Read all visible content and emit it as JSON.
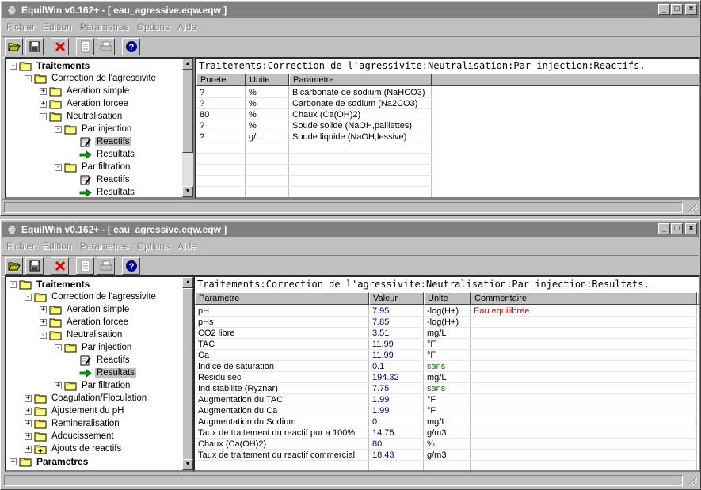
{
  "colors": {
    "title_inactive": "#808080",
    "selection": "#c0c0c0",
    "value_blue": "#000080",
    "comment_green": "#008000",
    "comment_red": "#c00000"
  },
  "windows": [
    {
      "title": "EquilWin v0.162+ - [ eau_agressive.eqw.eqw ]",
      "menu": [
        "Fichier",
        "Edition",
        "Parametres",
        "Options",
        "Aide"
      ],
      "toolbar": [
        "open-folder-icon",
        "save-disk-icon",
        "delete-x-icon",
        "copy-document-icon",
        "print-icon",
        "help-icon"
      ],
      "tree": [
        {
          "label": "Traitements",
          "level": 0,
          "expander": "-",
          "icon": "folder",
          "bold": true
        },
        {
          "label": "Correction de l'agressivite",
          "level": 1,
          "expander": "-",
          "icon": "folder"
        },
        {
          "label": "Aeration simple",
          "level": 2,
          "expander": "+",
          "icon": "folder"
        },
        {
          "label": "Aeration forcee",
          "level": 2,
          "expander": "+",
          "icon": "folder"
        },
        {
          "label": "Neutralisation",
          "level": 2,
          "expander": "-",
          "icon": "folder"
        },
        {
          "label": "Par injection",
          "level": 3,
          "expander": "-",
          "icon": "folder"
        },
        {
          "label": "Reactifs",
          "level": 4,
          "expander": "",
          "icon": "edit",
          "selected": true
        },
        {
          "label": "Resultats",
          "level": 4,
          "expander": "",
          "icon": "arrow"
        },
        {
          "label": "Par filtration",
          "level": 3,
          "expander": "-",
          "icon": "folder"
        },
        {
          "label": "Reactifs",
          "level": 4,
          "expander": "",
          "icon": "edit"
        },
        {
          "label": "Resultats",
          "level": 4,
          "expander": "",
          "icon": "arrow"
        }
      ],
      "path": "Traitements:Correction de l'agressivite:Neutralisation:Par injection:Reactifs.",
      "columns": [
        "Purete",
        "Unite",
        "Parametre"
      ],
      "rows": [
        [
          "?",
          "%",
          "Bicarbonate de sodium (NaHCO3)"
        ],
        [
          "?",
          "%",
          "Carbonate de sodium (Na2CO3)"
        ],
        [
          "80",
          "%",
          "Chaux (Ca(OH)2)"
        ],
        [
          "?",
          "%",
          "Soude solide (NaOH,paillettes)"
        ],
        [
          "?",
          "g/L",
          "Soude liquide (NaOH,lessive)"
        ]
      ]
    },
    {
      "title": "EquilWin v0.162+ - [ eau_agressive.eqw.eqw ]",
      "menu": [
        "Fichier",
        "Edition",
        "Parametres",
        "Options",
        "Aide"
      ],
      "toolbar": [
        "open-folder-icon",
        "save-disk-icon",
        "delete-x-icon",
        "copy-document-icon",
        "print-icon",
        "help-icon"
      ],
      "tree": [
        {
          "label": "Traitements",
          "level": 0,
          "expander": "-",
          "icon": "folder",
          "bold": true
        },
        {
          "label": "Correction de l'agressivite",
          "level": 1,
          "expander": "-",
          "icon": "folder"
        },
        {
          "label": "Aeration simple",
          "level": 2,
          "expander": "+",
          "icon": "folder"
        },
        {
          "label": "Aeration forcee",
          "level": 2,
          "expander": "+",
          "icon": "folder"
        },
        {
          "label": "Neutralisation",
          "level": 2,
          "expander": "-",
          "icon": "folder"
        },
        {
          "label": "Par injection",
          "level": 3,
          "expander": "-",
          "icon": "folder"
        },
        {
          "label": "Reactifs",
          "level": 4,
          "expander": "",
          "icon": "edit"
        },
        {
          "label": "Resultats",
          "level": 4,
          "expander": "",
          "icon": "arrow",
          "selected": true
        },
        {
          "label": "Par filtration",
          "level": 3,
          "expander": "+",
          "icon": "folder"
        },
        {
          "label": "Coagulation/Floculation",
          "level": 1,
          "expander": "+",
          "icon": "folder"
        },
        {
          "label": "Ajustement du pH",
          "level": 1,
          "expander": "+",
          "icon": "folder"
        },
        {
          "label": "Remineralisation",
          "level": 1,
          "expander": "+",
          "icon": "folder"
        },
        {
          "label": "Adoucissement",
          "level": 1,
          "expander": "+",
          "icon": "folder"
        },
        {
          "label": "Ajouts de reactifs",
          "level": 1,
          "expander": "+",
          "icon": "folder-plus"
        },
        {
          "label": "Parametres",
          "level": 0,
          "expander": "+",
          "icon": "folder",
          "bold": true
        }
      ],
      "path": "Traitements:Correction de l'agressivite:Neutralisation:Par injection:Resultats.",
      "columns": [
        "Parametre",
        "Valeur",
        "Unite",
        "Commentaire"
      ],
      "rows": [
        [
          "pH",
          "7.95",
          "-log(H+)",
          "Eau equilibree",
          "red"
        ],
        [
          "pHs",
          "7.85",
          "-log(H+)",
          "",
          ""
        ],
        [
          "CO2 libre",
          "3.51",
          "mg/L",
          "",
          ""
        ],
        [
          "TAC",
          "11.99",
          "°F",
          "",
          ""
        ],
        [
          "Ca",
          "11.99",
          "°F",
          "",
          ""
        ],
        [
          "Indice de saturation",
          "0.1",
          "sans",
          "",
          ""
        ],
        [
          "Residu sec",
          "194.32",
          "mg/L",
          "",
          ""
        ],
        [
          "Ind.stabilite (Ryznar)",
          "7.75",
          "sans",
          "",
          ""
        ],
        [
          "Augmentation du TAC",
          "1.99",
          "°F",
          "",
          ""
        ],
        [
          "Augmentation du Ca",
          "1.99",
          "°F",
          "",
          ""
        ],
        [
          "Augmentation du Sodium",
          "0",
          "mg/L",
          "",
          ""
        ],
        [
          "Taux de traitement du reactif pur a 100%",
          "14.75",
          "g/m3",
          "",
          ""
        ],
        [
          "Chaux (Ca(OH)2)",
          "80",
          "%",
          "",
          ""
        ],
        [
          "Taux de traitement du reactif commercial",
          "18.43",
          "g/m3",
          "",
          ""
        ]
      ]
    }
  ]
}
